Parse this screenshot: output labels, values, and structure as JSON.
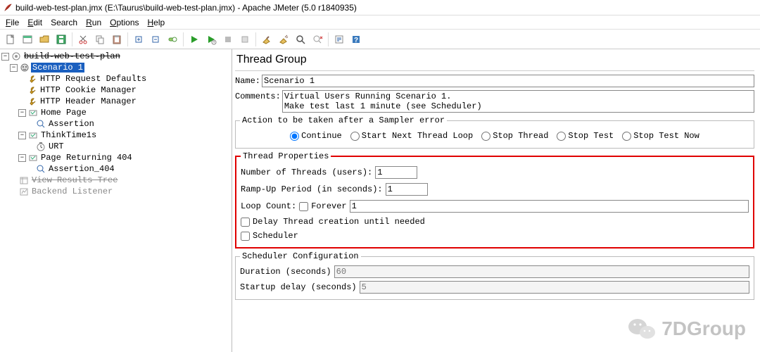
{
  "window": {
    "title": "build-web-test-plan.jmx (E:\\Taurus\\build-web-test-plan.jmx) - Apache JMeter (5.0 r1840935)"
  },
  "menu": {
    "file": "File",
    "edit": "Edit",
    "search": "Search",
    "run": "Run",
    "options": "Options",
    "help": "Help"
  },
  "tree": {
    "root": "build-web-test-plan",
    "scenario": "Scenario 1",
    "httpdefaults": "HTTP Request Defaults",
    "cookiemgr": "HTTP Cookie Manager",
    "headermgr": "HTTP Header Manager",
    "homepage": "Home Page",
    "assertion1": "Assertion",
    "thinktime": "ThinkTime1s",
    "urt": "URT",
    "page404": "Page Returning 404",
    "assertion404": "Assertion_404",
    "viewresults": "View Results Tree",
    "backend": "Backend Listener"
  },
  "panel": {
    "heading": "Thread Group",
    "name_lbl": "Name:",
    "name_val": "Scenario 1",
    "comments_lbl": "Comments:",
    "comments_val": "Virtual Users Running Scenario 1.\nMake test last 1 minute (see Scheduler)",
    "err_legend": "Action to be taken after a Sampler error",
    "radios": {
      "continue": "Continue",
      "nextloop": "Start Next Thread Loop",
      "stopthread": "Stop Thread",
      "stoptest": "Stop Test",
      "stopnow": "Stop Test Now"
    },
    "tp_legend": "Thread Properties",
    "threads_lbl": "Number of Threads (users):",
    "threads_val": "1",
    "ramp_lbl": "Ramp-Up Period (in seconds):",
    "ramp_val": "1",
    "loop_lbl": "Loop Count:",
    "forever_lbl": "Forever",
    "loop_val": "1",
    "delay_lbl": "Delay Thread creation until needed",
    "sched_lbl": "Scheduler",
    "schedconf_legend": "Scheduler Configuration",
    "duration_lbl": "Duration (seconds)",
    "duration_val": "60",
    "startup_lbl": "Startup delay (seconds)",
    "startup_val": "5"
  },
  "watermark": {
    "text": "7DGroup"
  }
}
